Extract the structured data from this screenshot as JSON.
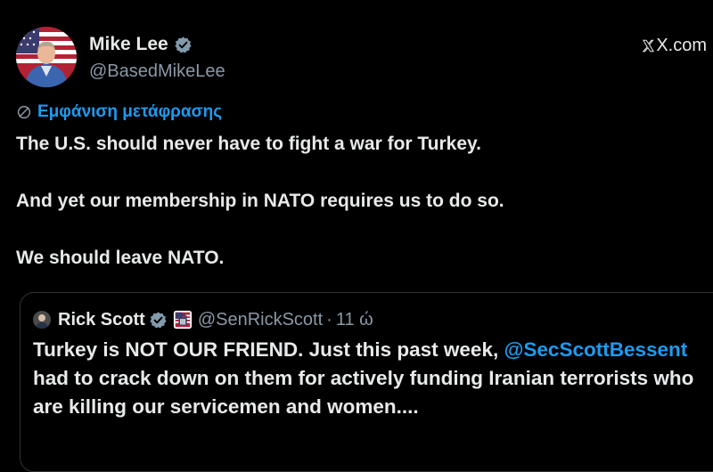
{
  "tweet": {
    "author": {
      "display_name": "Mike Lee",
      "handle": "@BasedMikeLee",
      "verified": true
    },
    "source": "X.com",
    "translate_link": "Εμφάνιση μετάφρασης",
    "paragraphs": [
      "The U.S. should never have to fight a war for Turkey.",
      "And yet our membership in NATO requires us to do so.",
      "We should leave NATO."
    ]
  },
  "quoted": {
    "display_name": "Rick Scott",
    "handle": "@SenRickScott",
    "separator": "·",
    "time": "11 ώ",
    "text_before_mention": "Turkey is NOT OUR FRIEND. Just this past week, ",
    "mention": "@SecScottBessent",
    "text_after_mention": " had to crack down on them for actively funding Iranian terrorists who are killing our servicemen and women...."
  },
  "colors": {
    "background": "#000000",
    "text": "#e7e9ea",
    "secondary": "#8b98a5",
    "link": "#1d9bf0",
    "verified": "#829aab",
    "border": "#2f3336"
  }
}
